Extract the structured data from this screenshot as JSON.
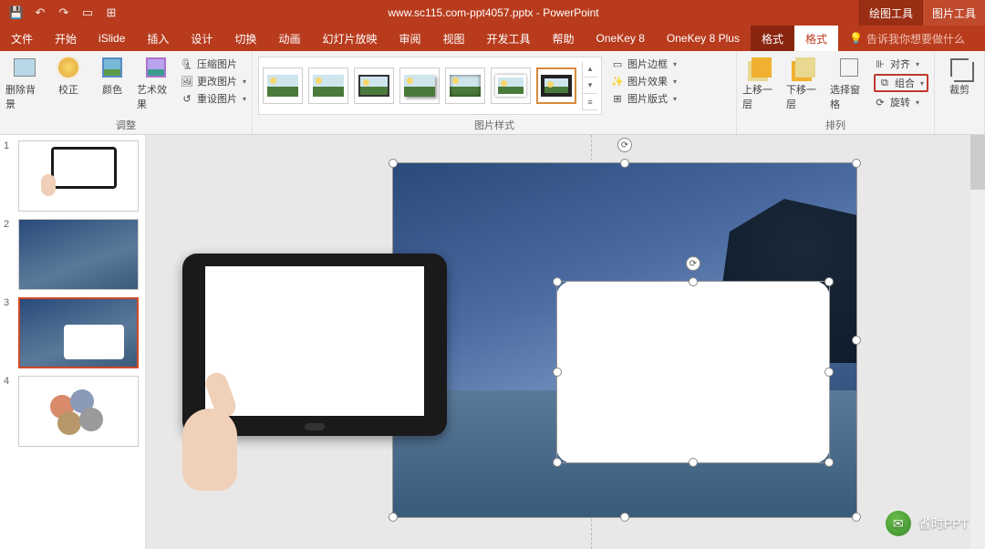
{
  "titlebar": {
    "filename": "www.sc115.com-ppt4057.pptx",
    "app": "PowerPoint",
    "sep": " - ",
    "context_tabs": [
      "绘图工具",
      "图片工具"
    ]
  },
  "tabs": {
    "file": "文件",
    "home": "开始",
    "islide": "iSlide",
    "insert": "插入",
    "design": "设计",
    "transitions": "切换",
    "animations": "动画",
    "slideshow": "幻灯片放映",
    "review": "审阅",
    "view": "视图",
    "developer": "开发工具",
    "help": "帮助",
    "onekey8": "OneKey 8",
    "onekey8plus": "OneKey 8 Plus",
    "format1": "格式",
    "format2": "格式",
    "tell_me": "告诉我你想要做什么"
  },
  "ribbon": {
    "adjust": {
      "remove_bg": "删除背景",
      "corrections": "校正",
      "color": "颜色",
      "artistic": "艺术效果",
      "compress": "压缩图片",
      "change": "更改图片",
      "reset": "重设图片",
      "group_label": "调整"
    },
    "styles": {
      "border": "图片边框",
      "effects": "图片效果",
      "layout": "图片版式",
      "group_label": "图片样式"
    },
    "arrange": {
      "bring_forward": "上移一层",
      "send_backward": "下移一层",
      "selection_pane": "选择窗格",
      "align": "对齐",
      "group": "组合",
      "rotate": "旋转",
      "group_label": "排列"
    },
    "crop": {
      "label": "裁剪"
    }
  },
  "thumbnails": [
    {
      "num": "1"
    },
    {
      "num": "2"
    },
    {
      "num": "3"
    },
    {
      "num": "4"
    }
  ],
  "watermark": {
    "text": "省时PPT"
  }
}
